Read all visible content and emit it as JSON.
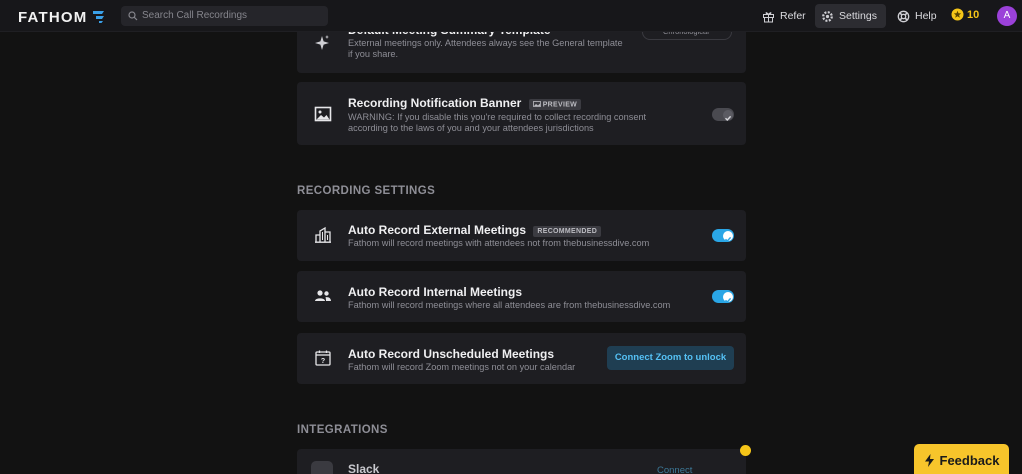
{
  "app": {
    "name": "FATHOM"
  },
  "search": {
    "placeholder": "Search Call Recordings"
  },
  "topnav": {
    "refer": "Refer",
    "settings": "Settings",
    "help": "Help",
    "coins": "10",
    "avatar": "A"
  },
  "top_card": {
    "title": "Default Meeting Summary Template",
    "desc": "External meetings only. Attendees always see the General template if you share.",
    "dropdown": "Chronological"
  },
  "banner_card": {
    "title": "Recording Notification Banner",
    "badge": "PREVIEW",
    "desc": "WARNING: If you disable this you're required to collect recording consent according to the laws of you and your attendees jurisdictions",
    "toggle_on": false
  },
  "recording_settings": {
    "heading": "RECORDING SETTINGS",
    "items": [
      {
        "title": "Auto Record External Meetings",
        "badge": "RECOMMENDED",
        "desc": "Fathom will record meetings with attendees not from thebusinessdive.com",
        "toggle_on": true
      },
      {
        "title": "Auto Record Internal Meetings",
        "desc": "Fathom will record meetings where all attendees are from thebusinessdive.com",
        "toggle_on": true
      },
      {
        "title": "Auto Record Unscheduled Meetings",
        "desc": "Fathom will record Zoom meetings not on your calendar",
        "button": "Connect Zoom to unlock"
      }
    ]
  },
  "integrations": {
    "heading": "INTEGRATIONS",
    "items": [
      {
        "title": "Slack",
        "button": "Connect"
      }
    ]
  },
  "feedback": {
    "label": "Feedback"
  },
  "colors": {
    "accent": "#2aa6e6",
    "brand_yellow": "#f7c52b",
    "avatar": "#9b41d9"
  }
}
